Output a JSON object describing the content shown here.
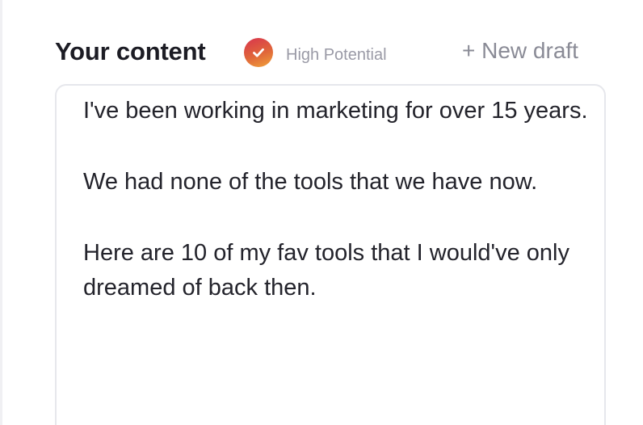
{
  "header": {
    "title": "Your content",
    "badge_icon": "check-circle-icon",
    "badge_label": "High Potential",
    "new_draft_label": "+ New draft"
  },
  "editor": {
    "paragraphs": [
      "I've been working in marketing for over 15 years.",
      "We had none of the tools that we have now.",
      "Here are 10 of my fav tools that I would've only dreamed of back then."
    ]
  },
  "colors": {
    "badge_gradient_start": "#d8344e",
    "badge_gradient_end": "#f0a33a",
    "title_text": "#1c1c24",
    "muted_text": "#9a9aa6"
  }
}
